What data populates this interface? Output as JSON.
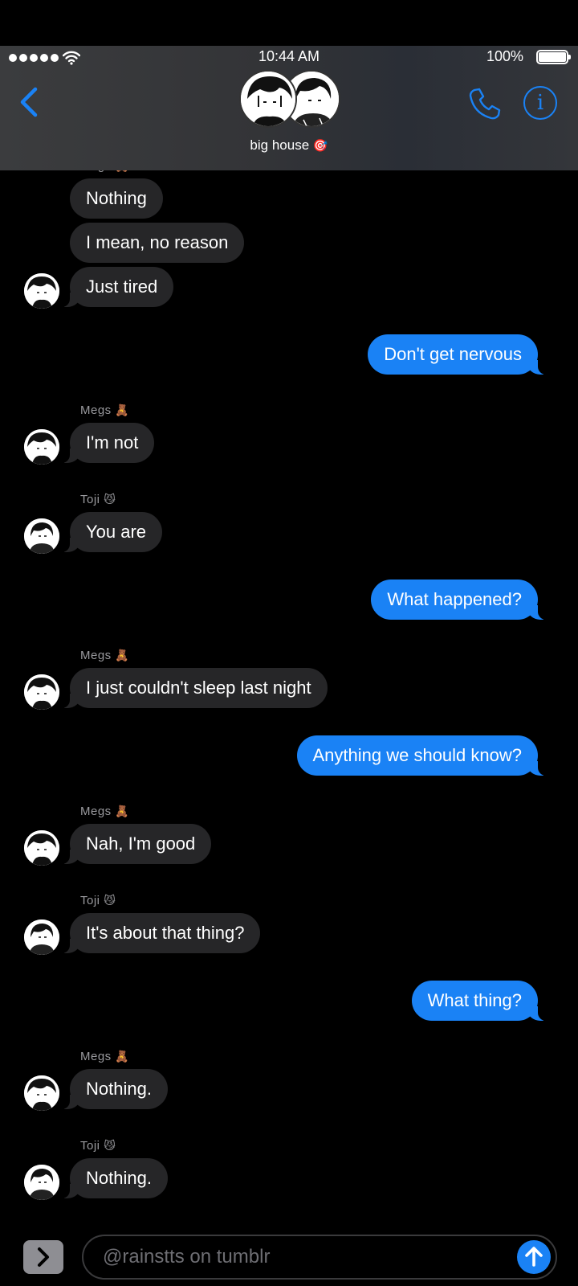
{
  "status_bar": {
    "time": "10:44 AM",
    "battery": "100%",
    "signal_bars": 5
  },
  "header": {
    "title": "big house",
    "title_emoji": "🎯",
    "back_icon": "chevron-left-icon",
    "call_icon": "phone-icon",
    "info_label": "i"
  },
  "participants": [
    {
      "name": "Megs",
      "emoji": "🧸"
    },
    {
      "name": "Toji",
      "emoji": "😼"
    }
  ],
  "messages": [
    {
      "from": "Megs",
      "text": "Nothing"
    },
    {
      "from": "Megs",
      "text": "I mean, no reason"
    },
    {
      "from": "Megs",
      "text": "Just tired"
    },
    {
      "from": "me",
      "text": "Don't get nervous"
    },
    {
      "from": "Megs",
      "text": "I'm not"
    },
    {
      "from": "Toji",
      "text": "You are"
    },
    {
      "from": "me",
      "text": "What happened?"
    },
    {
      "from": "Megs",
      "text": "I just couldn't sleep last night"
    },
    {
      "from": "me",
      "text": "Anything we should know?"
    },
    {
      "from": "Megs",
      "text": "Nah, I'm good"
    },
    {
      "from": "Toji",
      "text": "It's about that thing?"
    },
    {
      "from": "me",
      "text": "What thing?"
    },
    {
      "from": "Megs",
      "text": "Nothing."
    },
    {
      "from": "Toji",
      "text": "Nothing."
    }
  ],
  "composer": {
    "placeholder": "@rainstts on tumblr",
    "value": ""
  },
  "colors": {
    "accent": "#1a82f5",
    "incoming_bubble": "#262628",
    "background": "#000000"
  }
}
